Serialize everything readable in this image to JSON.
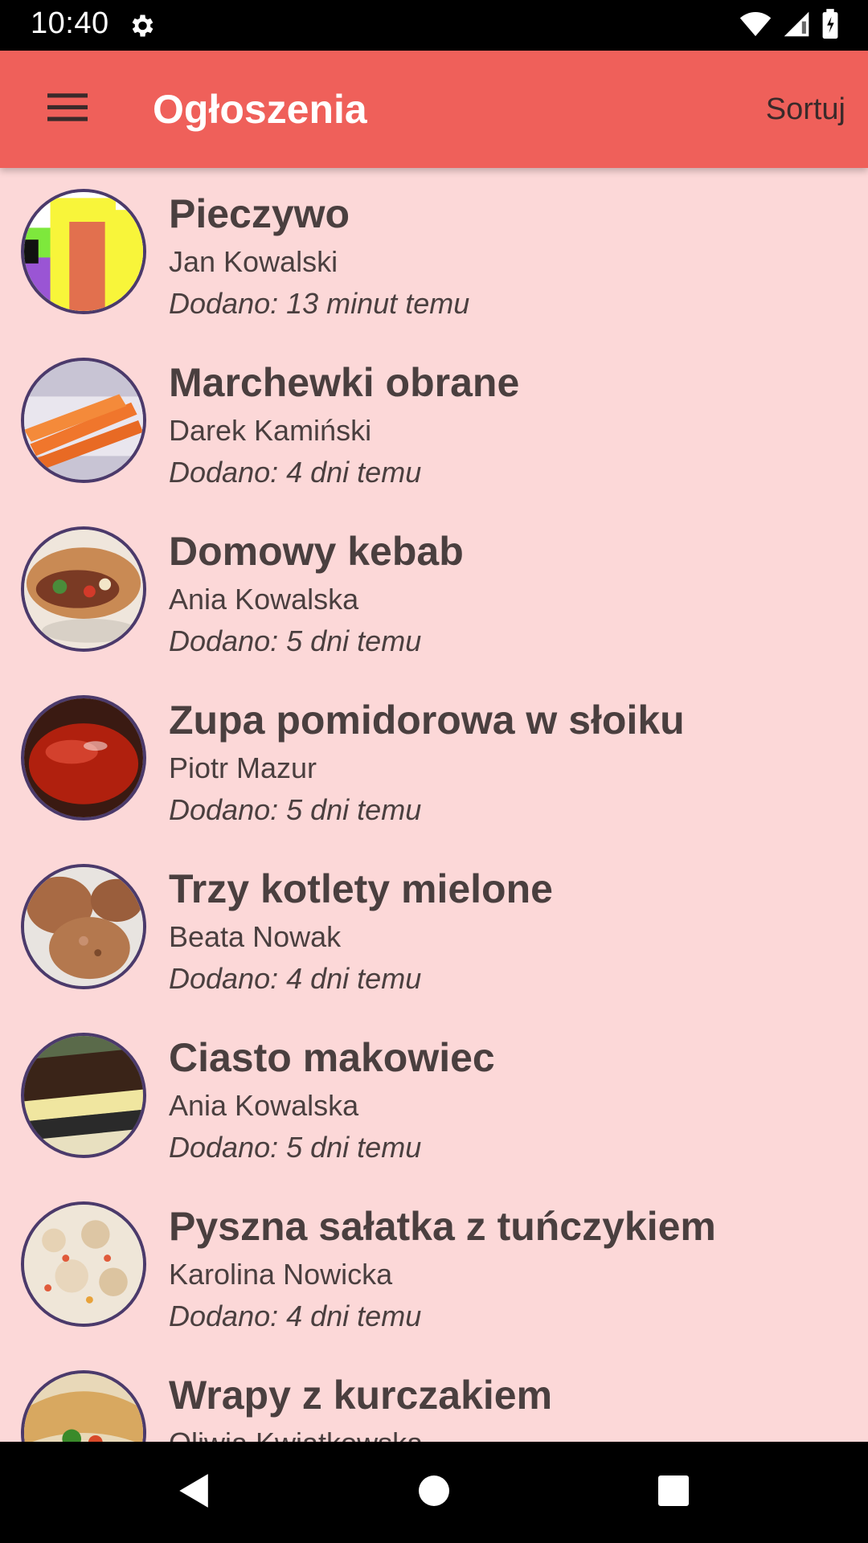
{
  "status_bar": {
    "time": "10:40",
    "icons": [
      "gear-icon",
      "wifi-icon",
      "signal-icon",
      "battery-icon"
    ]
  },
  "app_bar": {
    "title": "Ogłoszenia",
    "sort_label": "Sortuj",
    "menu_icon": "hamburger-menu-icon",
    "color": "#ef605a"
  },
  "colors": {
    "list_background": "#fcd8d8",
    "text": "#4a3f3f",
    "thumb_border": "#4b3a6b"
  },
  "listings": [
    {
      "title": "Pieczywo",
      "author": "Jan Kowalski",
      "added": "Dodano: 13 minut temu",
      "image": "placeholder-colored-blocks"
    },
    {
      "title": "Marchewki obrane",
      "author": "Darek Kamiński",
      "added": "Dodano: 4 dni temu",
      "image": "peeled-carrots"
    },
    {
      "title": "Domowy kebab",
      "author": "Ania Kowalska",
      "added": "Dodano: 5 dni temu",
      "image": "kebab-wraps"
    },
    {
      "title": "Zupa pomidorowa w słoiku",
      "author": "Piotr Mazur",
      "added": "Dodano: 5 dni temu",
      "image": "tomato-soup-jar"
    },
    {
      "title": "Trzy kotlety mielone",
      "author": "Beata Nowak",
      "added": "Dodano: 4 dni temu",
      "image": "minced-cutlets"
    },
    {
      "title": "Ciasto makowiec",
      "author": "Ania Kowalska",
      "added": "Dodano: 5 dni temu",
      "image": "poppy-seed-cake"
    },
    {
      "title": "Pyszna sałatka z tuńczykiem",
      "author": "Karolina Nowicka",
      "added": "Dodano: 4 dni temu",
      "image": "tuna-salad"
    },
    {
      "title": "Wrapy z kurczakiem",
      "author": "Oliwia Kwiatkowska",
      "added": "",
      "image": "chicken-wraps"
    }
  ],
  "nav_bar": {
    "icons": [
      "back-icon",
      "home-icon",
      "recents-icon"
    ]
  }
}
